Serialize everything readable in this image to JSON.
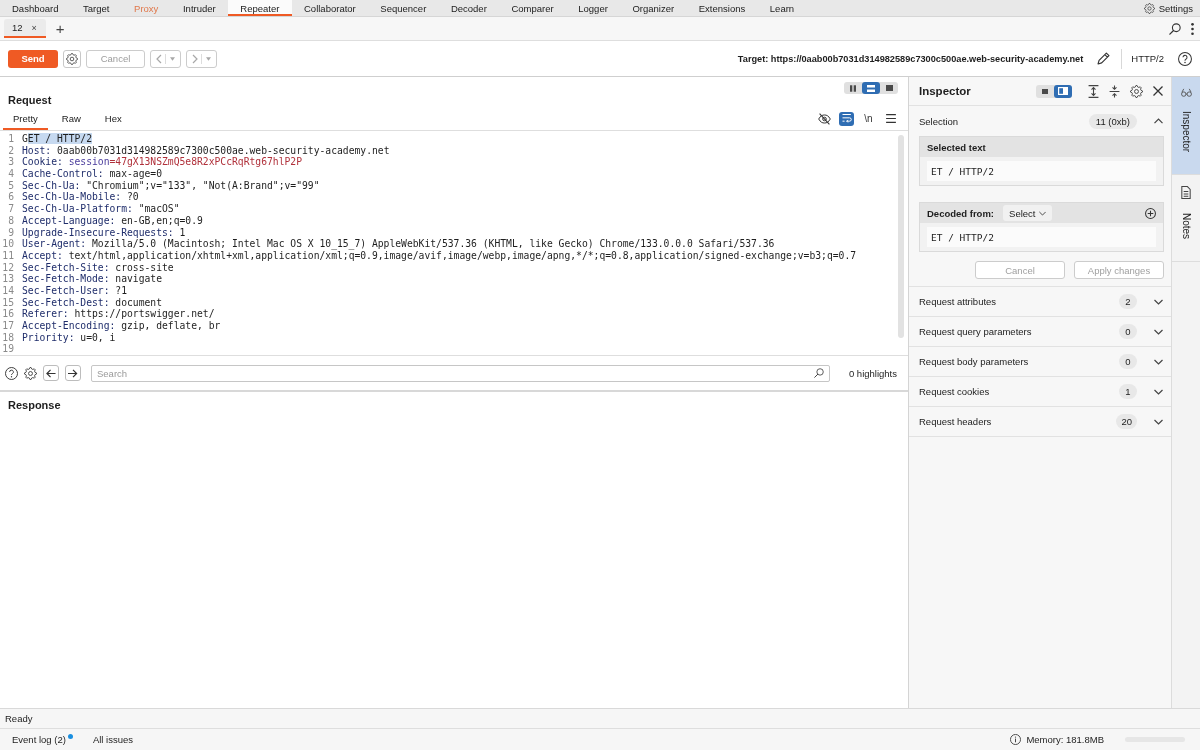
{
  "menu_bar": {
    "items": [
      {
        "label": "Dashboard",
        "selected": false,
        "highlighted": false
      },
      {
        "label": "Target",
        "selected": false,
        "highlighted": false
      },
      {
        "label": "Proxy",
        "selected": false,
        "highlighted": true
      },
      {
        "label": "Intruder",
        "selected": false,
        "highlighted": false
      },
      {
        "label": "Repeater",
        "selected": true,
        "highlighted": false
      },
      {
        "label": "Collaborator",
        "selected": false,
        "highlighted": false
      },
      {
        "label": "Sequencer",
        "selected": false,
        "highlighted": false
      },
      {
        "label": "Decoder",
        "selected": false,
        "highlighted": false
      },
      {
        "label": "Comparer",
        "selected": false,
        "highlighted": false
      },
      {
        "label": "Logger",
        "selected": false,
        "highlighted": false
      },
      {
        "label": "Organizer",
        "selected": false,
        "highlighted": false
      },
      {
        "label": "Extensions",
        "selected": false,
        "highlighted": false
      },
      {
        "label": "Learn",
        "selected": false,
        "highlighted": false
      }
    ],
    "settings": "Settings"
  },
  "tab_bar": {
    "tabs": [
      {
        "label": "12",
        "close": "×",
        "selected": true
      }
    ],
    "add": "+"
  },
  "toolbar": {
    "send": "Send",
    "cancel": {
      "label": "Cancel",
      "disabled": true
    },
    "history": [
      {
        "kind": "back",
        "disabled": true
      },
      {
        "kind": "forward",
        "disabled": true
      }
    ],
    "target": "Target: https://0aab00b7031d314982589c7300c500ae.web-security-academy.net",
    "protocol": "HTTP/2"
  },
  "request": {
    "layout_modes": [
      {
        "kind": "columns",
        "selected": false
      },
      {
        "kind": "rows",
        "selected": true
      },
      {
        "kind": "single",
        "selected": false
      }
    ],
    "title": "Request",
    "view_tabs": [
      {
        "label": "Pretty",
        "selected": true
      },
      {
        "label": "Raw",
        "selected": false
      },
      {
        "label": "Hex",
        "selected": false
      }
    ],
    "tools": [
      {
        "kind": "hide",
        "selected": false
      },
      {
        "kind": "wrap",
        "selected": true
      },
      {
        "kind": "newline",
        "label": "\\n",
        "selected": false
      },
      {
        "kind": "menu",
        "selected": false
      }
    ],
    "lines": [
      {
        "number": "1",
        "segments": [
          {
            "kind": "plain",
            "text": "G"
          },
          {
            "kind": "highlight",
            "text": "ET / HTTP/2"
          }
        ]
      },
      {
        "number": "2",
        "segments": [
          {
            "kind": "key",
            "text": "Host:"
          },
          {
            "kind": "value",
            "text": "0aab00b7031d314982589c7300c500ae.web-security-academy.net"
          }
        ]
      },
      {
        "number": "3",
        "segments": [
          {
            "kind": "key",
            "text": "Cookie:"
          },
          {
            "kind": "cookie",
            "text": "session"
          },
          {
            "kind": "token",
            "text": "=47gX13NSZmQ5e8R2xPCcRqRtg67hlP2P"
          }
        ]
      },
      {
        "number": "4",
        "segments": [
          {
            "kind": "key",
            "text": "Cache-Control:"
          },
          {
            "kind": "value",
            "text": "max-age=0"
          }
        ]
      },
      {
        "number": "5",
        "segments": [
          {
            "kind": "key",
            "text": "Sec-Ch-Ua:"
          },
          {
            "kind": "value",
            "text": "\"Chromium\";v=\"133\", \"Not(A:Brand\";v=\"99\""
          }
        ]
      },
      {
        "number": "6",
        "segments": [
          {
            "kind": "key",
            "text": "Sec-Ch-Ua-Mobile:"
          },
          {
            "kind": "value",
            "text": "?0"
          }
        ]
      },
      {
        "number": "7",
        "segments": [
          {
            "kind": "key",
            "text": "Sec-Ch-Ua-Platform:"
          },
          {
            "kind": "value",
            "text": "\"macOS\""
          }
        ]
      },
      {
        "number": "8",
        "segments": [
          {
            "kind": "key",
            "text": "Accept-Language:"
          },
          {
            "kind": "value",
            "text": "en-GB,en;q=0.9"
          }
        ]
      },
      {
        "number": "9",
        "segments": [
          {
            "kind": "key",
            "text": "Upgrade-Insecure-Requests:"
          },
          {
            "kind": "value",
            "text": "1"
          }
        ]
      },
      {
        "number": "10",
        "segments": [
          {
            "kind": "key",
            "text": "User-Agent:"
          },
          {
            "kind": "value",
            "text": "Mozilla/5.0 (Macintosh; Intel Mac OS X 10_15_7) AppleWebKit/537.36 (KHTML, like Gecko) Chrome/133.0.0.0 Safari/537.36"
          }
        ]
      },
      {
        "number": "11",
        "segments": [
          {
            "kind": "key",
            "text": "Accept:"
          },
          {
            "kind": "value",
            "text": "text/html,application/xhtml+xml,application/xml;q=0.9,image/avif,image/webp,image/apng,*/*;q=0.8,application/signed-exchange;v=b3;q=0.7"
          }
        ]
      },
      {
        "number": "12",
        "segments": [
          {
            "kind": "key",
            "text": "Sec-Fetch-Site:"
          },
          {
            "kind": "value",
            "text": "cross-site"
          }
        ]
      },
      {
        "number": "13",
        "segments": [
          {
            "kind": "key",
            "text": "Sec-Fetch-Mode:"
          },
          {
            "kind": "value",
            "text": "navigate"
          }
        ]
      },
      {
        "number": "14",
        "segments": [
          {
            "kind": "key",
            "text": "Sec-Fetch-User:"
          },
          {
            "kind": "value",
            "text": "?1"
          }
        ]
      },
      {
        "number": "15",
        "segments": [
          {
            "kind": "key",
            "text": "Sec-Fetch-Dest:"
          },
          {
            "kind": "value",
            "text": "document"
          }
        ]
      },
      {
        "number": "16",
        "segments": [
          {
            "kind": "key",
            "text": "Referer:"
          },
          {
            "kind": "value",
            "text": "https://portswigger.net/"
          }
        ]
      },
      {
        "number": "17",
        "segments": [
          {
            "kind": "key",
            "text": "Accept-Encoding:"
          },
          {
            "kind": "value",
            "text": "gzip, deflate, br"
          }
        ]
      },
      {
        "number": "18",
        "segments": [
          {
            "kind": "key",
            "text": "Priority:"
          },
          {
            "kind": "value",
            "text": "u=0, i"
          }
        ]
      },
      {
        "number": "19"
      }
    ],
    "search": {
      "placeholder": "Search",
      "highlights": "0 highlights"
    }
  },
  "response": {
    "title": "Response"
  },
  "inspector": {
    "title": "Inspector",
    "layout_modes": [
      {
        "kind": "narrow",
        "selected": false
      },
      {
        "kind": "wide",
        "selected": true
      }
    ],
    "selection": {
      "label": "Selection",
      "count": "11 (0xb)",
      "expanded": true,
      "selected_text": {
        "label": "Selected text",
        "value": "ET / HTTP/2"
      },
      "decoded_from": {
        "label": "Decoded from:",
        "dropdown": "Select",
        "value": "ET / HTTP/2"
      },
      "buttons": [
        {
          "label": "Cancel",
          "disabled": true
        },
        {
          "label": "Apply changes",
          "disabled": true
        }
      ]
    },
    "sections": [
      {
        "label": "Request attributes",
        "count": "2",
        "expanded": false
      },
      {
        "label": "Request query parameters",
        "count": "0",
        "expanded": false
      },
      {
        "label": "Request body parameters",
        "count": "0",
        "expanded": false
      },
      {
        "label": "Request cookies",
        "count": "1",
        "expanded": false
      },
      {
        "label": "Request headers",
        "count": "20",
        "expanded": false
      }
    ]
  },
  "side_tabs": [
    {
      "kind": "inspector",
      "label": "Inspector",
      "selected": true
    },
    {
      "kind": "notes",
      "label": "Notes",
      "selected": false
    }
  ],
  "status_bar": {
    "text": "Ready"
  },
  "footer": {
    "event_log": {
      "label": "Event log (2)",
      "unread": true
    },
    "all_issues": "All issues",
    "memory": "Memory: 181.8MB"
  }
}
